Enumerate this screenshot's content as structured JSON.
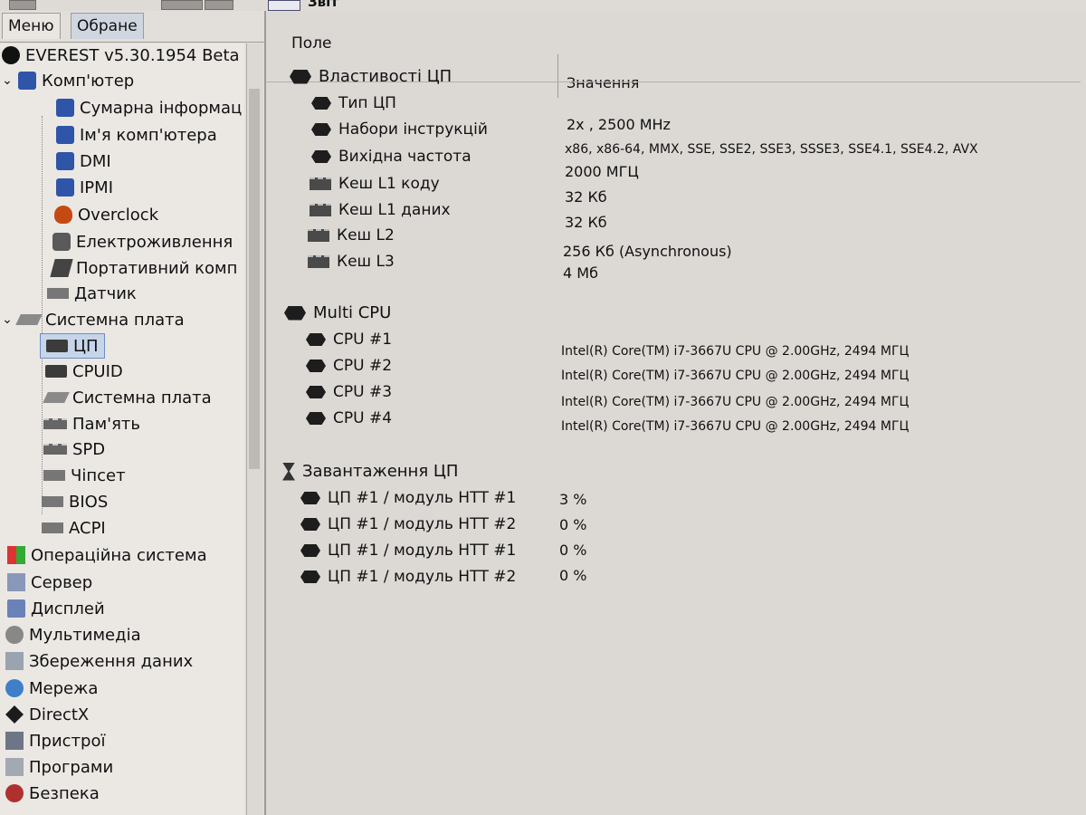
{
  "toolbar": {
    "report_label": "Звіт"
  },
  "tabs": [
    {
      "label": "Меню"
    },
    {
      "label": "Обране"
    }
  ],
  "tree": {
    "app_title": "EVEREST v5.30.1954 Beta",
    "computer": "Комп'ютер",
    "computer_children": [
      "Сумарна інформац",
      "Ім'я комп'ютера",
      "DMI",
      "IPMI",
      "Overclock",
      "Електроживлення",
      "Портативний комп",
      "Датчик"
    ],
    "motherboard": "Системна плата",
    "motherboard_children": [
      "ЦП",
      "CPUID",
      "Системна плата",
      "Пам'ять",
      "SPD",
      "Чіпсет",
      "BIOS",
      "ACPI"
    ],
    "root_items": [
      "Операційна система",
      "Сервер",
      "Дисплей",
      "Мультимедіа",
      "Збереження даних",
      "Мережа",
      "DirectX",
      "Пристрої",
      "Програми",
      "Безпека"
    ]
  },
  "columns": {
    "field": "Поле",
    "value": "Значення"
  },
  "groups": {
    "cpu_props": {
      "title": "Властивості ЦП",
      "rows": [
        {
          "field": "Тип ЦП",
          "value": "2x , 2500 MHz"
        },
        {
          "field": "Набори інструкцій",
          "value": "x86, x86-64, MMX, SSE, SSE2, SSE3, SSSE3, SSE4.1, SSE4.2, AVX"
        },
        {
          "field": "Вихідна частота",
          "value": "2000 МГЦ"
        },
        {
          "field": "Кеш L1 коду",
          "value": "32 Кб"
        },
        {
          "field": "Кеш L1 даних",
          "value": "32 Кб"
        },
        {
          "field": "Кеш L2",
          "value": "256 Кб  (Asynchronous)"
        },
        {
          "field": "Кеш L3",
          "value": "4 Мб"
        }
      ]
    },
    "multi_cpu": {
      "title": "Multi CPU",
      "rows": [
        {
          "field": "CPU #1",
          "value": "Intel(R) Core(TM) i7-3667U CPU @ 2.00GHz, 2494 МГЦ"
        },
        {
          "field": "CPU #2",
          "value": "Intel(R) Core(TM) i7-3667U CPU @ 2.00GHz, 2494 МГЦ"
        },
        {
          "field": "CPU #3",
          "value": "Intel(R) Core(TM) i7-3667U CPU @ 2.00GHz, 2494 МГЦ"
        },
        {
          "field": "CPU #4",
          "value": "Intel(R) Core(TM) i7-3667U CPU @ 2.00GHz, 2494 МГЦ"
        }
      ]
    },
    "cpu_load": {
      "title": "Завантаження ЦП",
      "rows": [
        {
          "field": "ЦП #1 / модуль НТТ #1",
          "value": "3 %"
        },
        {
          "field": "ЦП #1 / модуль НТТ #2",
          "value": "0 %"
        },
        {
          "field": "ЦП #1 / модуль НТТ #1",
          "value": "0 %"
        },
        {
          "field": "ЦП #1 / модуль НТТ #2",
          "value": "0 %"
        }
      ]
    }
  }
}
